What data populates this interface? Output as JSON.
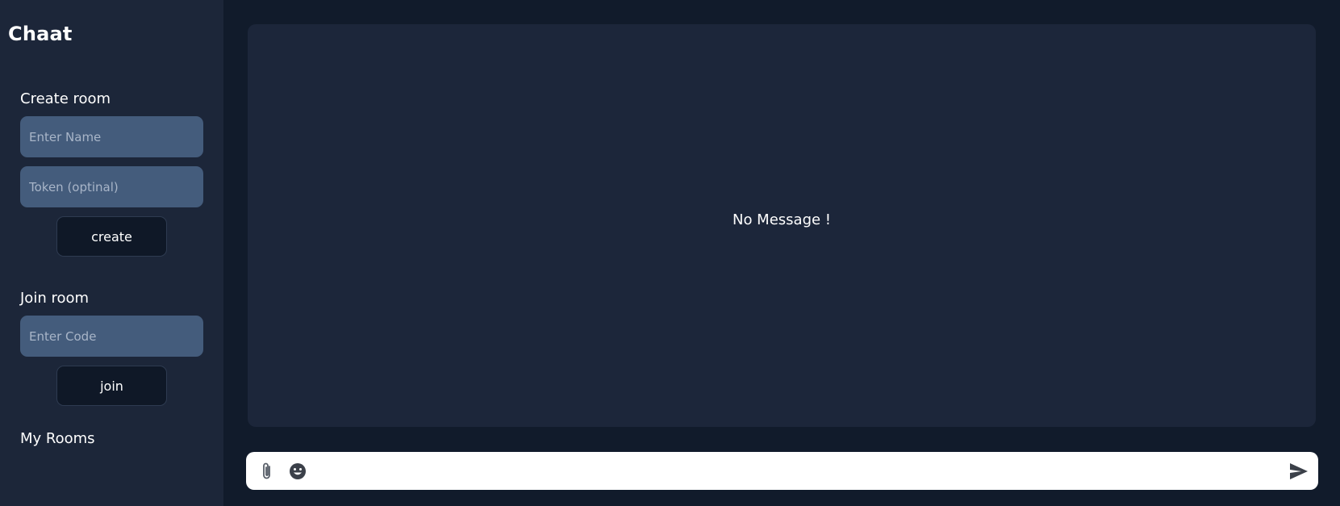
{
  "app": {
    "title": "Chaat"
  },
  "sidebar": {
    "create_room": {
      "heading": "Create room",
      "name_placeholder": "Enter Name",
      "token_placeholder": "Token (optinal)",
      "button_label": "create"
    },
    "join_room": {
      "heading": "Join room",
      "code_placeholder": "Enter Code",
      "button_label": "join"
    },
    "my_rooms": {
      "heading": "My Rooms",
      "items": []
    }
  },
  "messages": {
    "empty_text": "No Message !"
  },
  "composer": {
    "value": "",
    "icons": {
      "attach": "paperclip-icon",
      "emoji": "smiley-icon",
      "send": "send-icon"
    }
  },
  "colors": {
    "page_background": "#111b2b",
    "sidebar_background": "#1c2639",
    "input_background": "#445c7c",
    "button_background": "#0f1827",
    "panel_background": "#1c263a",
    "composer_background": "#ffffff",
    "text": "#ffffff"
  }
}
